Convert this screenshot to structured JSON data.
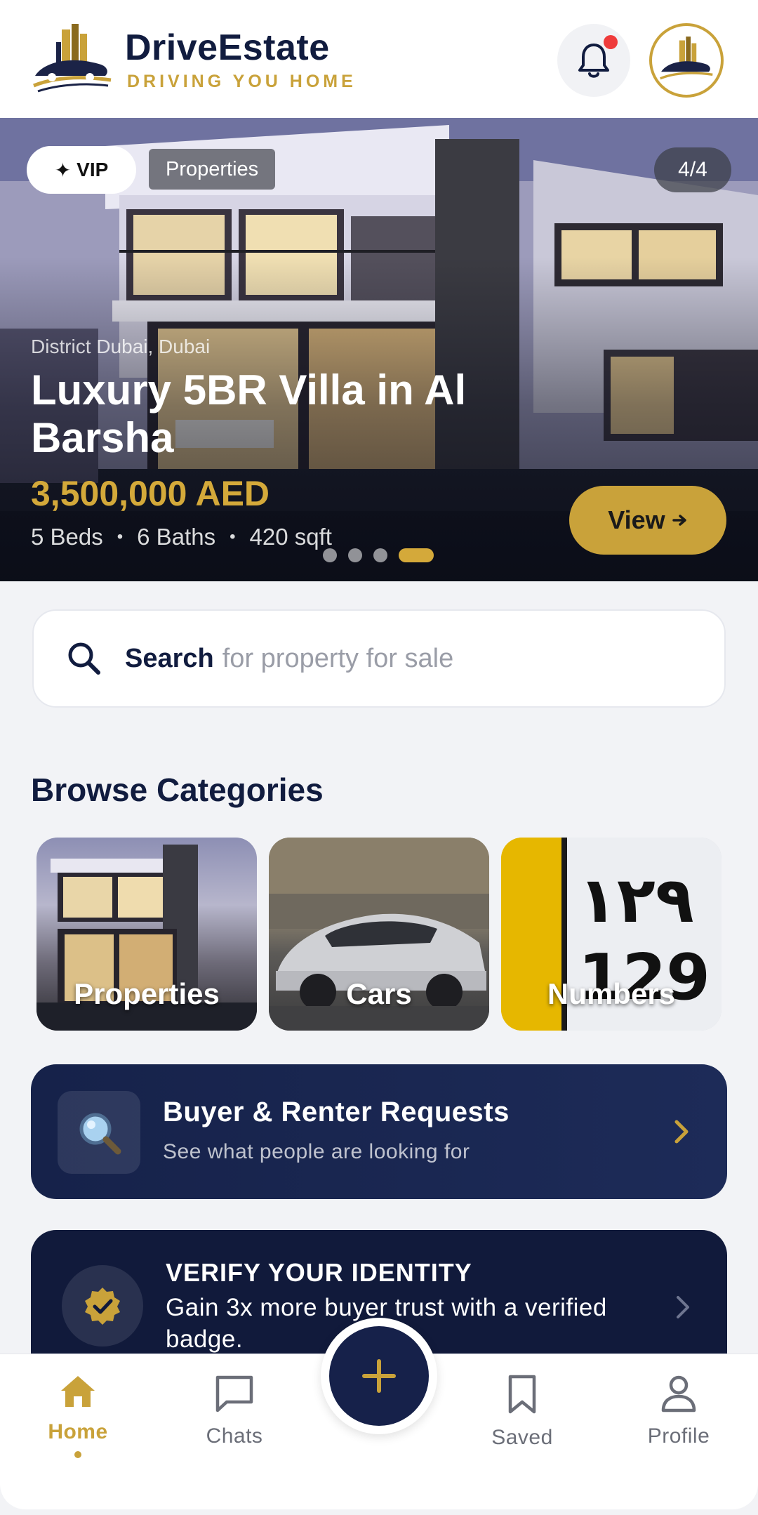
{
  "header": {
    "brand_name": "DriveEstate",
    "brand_tagline": "DRIVING YOU HOME",
    "notification_badge": true
  },
  "hero": {
    "vip_label": "VIP",
    "category_label": "Properties",
    "counter": "4/4",
    "location": "District Dubai, Dubai",
    "title": "Luxury 5BR Villa in Al Barsha",
    "price": "3,500,000 AED",
    "specs": [
      "5 Beds",
      "6 Baths",
      "420 sqft"
    ],
    "view_label": "View",
    "slide_count": 4,
    "active_slide": 4
  },
  "search": {
    "bold_text": "Search",
    "placeholder": "for property for sale"
  },
  "categories": {
    "title": "Browse Categories",
    "items": [
      {
        "label": "Properties"
      },
      {
        "label": "Cars"
      },
      {
        "label": "Numbers"
      }
    ]
  },
  "requests_banner": {
    "title": "Buyer & Renter Requests",
    "subtitle": "See what people are looking for",
    "icon": "magnifier-icon"
  },
  "verify_banner": {
    "title": "VERIFY YOUR IDENTITY",
    "subtitle": "Gain 3x more buyer trust with a verified badge.",
    "icon": "verified-badge-icon"
  },
  "bottom_nav": {
    "items": [
      {
        "label": "Home",
        "icon": "home-icon",
        "active": true
      },
      {
        "label": "Chats",
        "icon": "chat-icon",
        "active": false
      },
      {
        "label": "Saved",
        "icon": "bookmark-icon",
        "active": false
      },
      {
        "label": "Profile",
        "icon": "user-icon",
        "active": false
      }
    ],
    "fab_icon": "plus-icon"
  },
  "colors": {
    "accent_gold": "#c9a23a",
    "navy": "#111c3f",
    "notification_red": "#ef3b3b"
  }
}
